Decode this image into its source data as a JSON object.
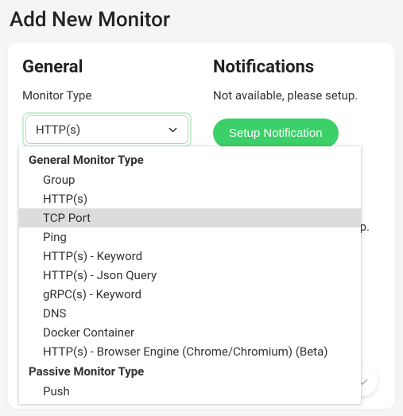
{
  "page": {
    "title": "Add New Monitor"
  },
  "general": {
    "heading": "General",
    "monitorTypeLabel": "Monitor Type",
    "selectedValue": "HTTP(s)"
  },
  "notifications": {
    "heading": "Notifications",
    "statusText": "Not available, please setup.",
    "setupButton": "Setup Notification"
  },
  "partiallyObscured": {
    "fragment": "p."
  },
  "dropdown": {
    "groups": [
      {
        "label": "General Monitor Type",
        "options": [
          {
            "label": "Group",
            "highlighted": false
          },
          {
            "label": "HTTP(s)",
            "highlighted": false
          },
          {
            "label": "TCP Port",
            "highlighted": true
          },
          {
            "label": "Ping",
            "highlighted": false
          },
          {
            "label": "HTTP(s) - Keyword",
            "highlighted": false
          },
          {
            "label": "HTTP(s) - Json Query",
            "highlighted": false
          },
          {
            "label": "gRPC(s) - Keyword",
            "highlighted": false
          },
          {
            "label": "DNS",
            "highlighted": false
          },
          {
            "label": "Docker Container",
            "highlighted": false
          },
          {
            "label": "HTTP(s) - Browser Engine (Chrome/Chromium) (Beta)",
            "highlighted": false
          }
        ]
      },
      {
        "label": "Passive Monitor Type",
        "options": [
          {
            "label": "Push",
            "highlighted": false
          }
        ]
      }
    ]
  }
}
